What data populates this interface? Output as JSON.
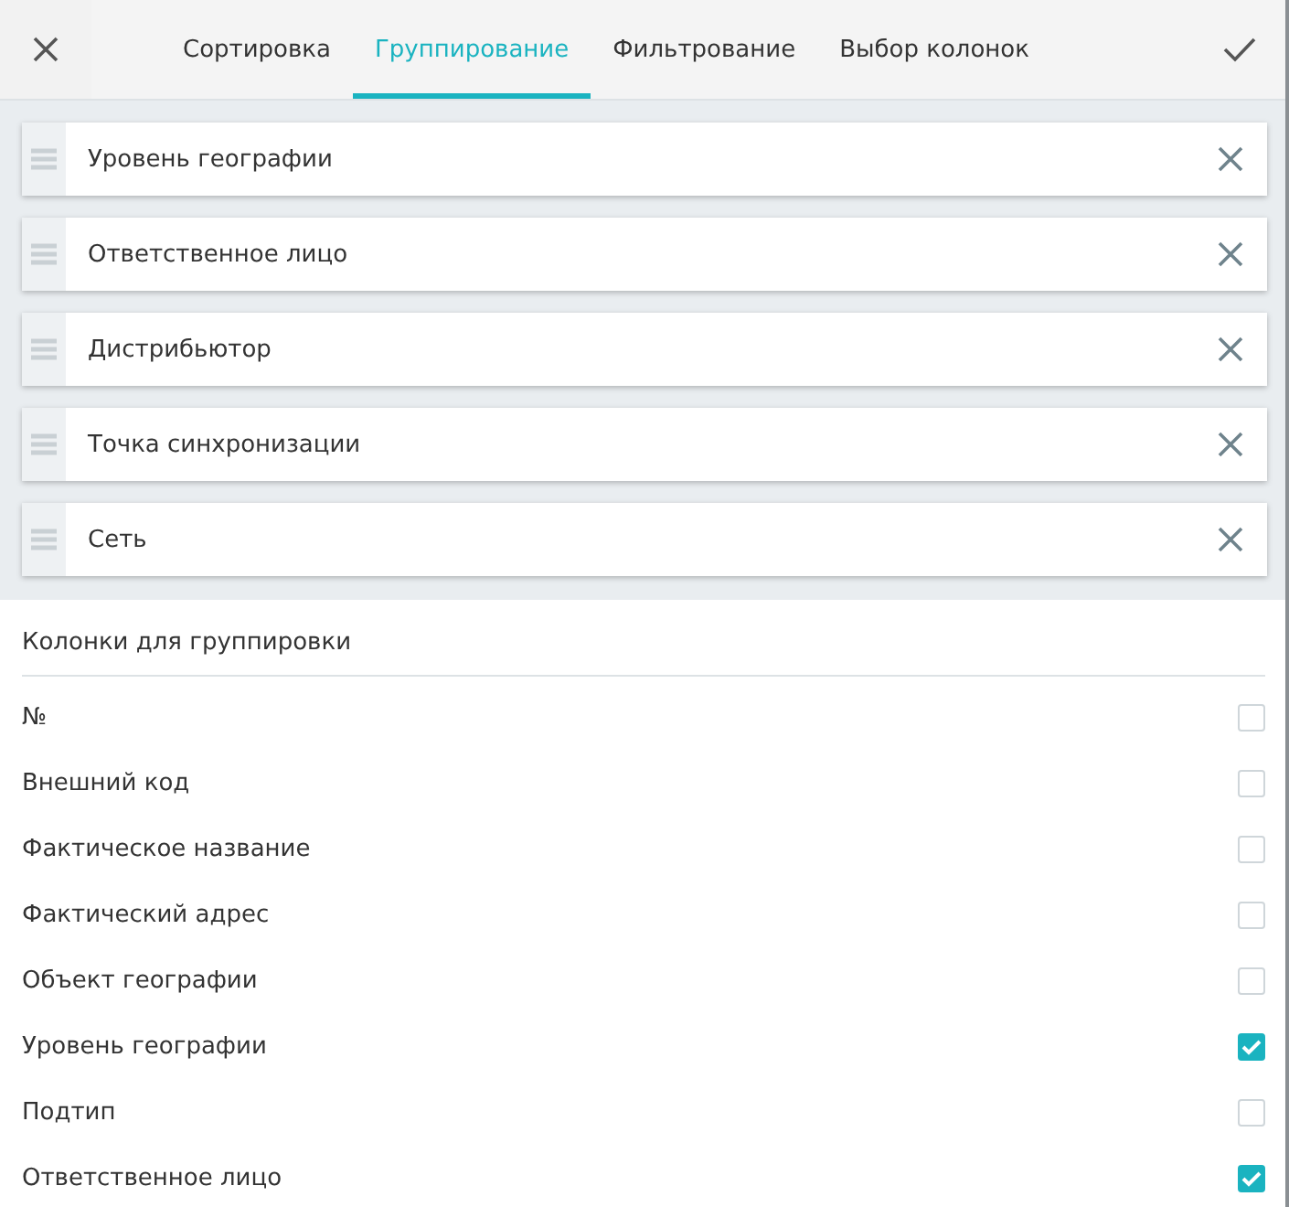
{
  "tabs": [
    {
      "label": "Сортировка",
      "selected": false
    },
    {
      "label": "Группирование",
      "selected": true
    },
    {
      "label": "Фильтрование",
      "selected": false
    },
    {
      "label": "Выбор колонок",
      "selected": false
    }
  ],
  "groups": [
    {
      "label": "Уровень географии"
    },
    {
      "label": "Ответственное лицо"
    },
    {
      "label": "Дистрибьютор"
    },
    {
      "label": "Точка синхронизации"
    },
    {
      "label": "Сеть"
    }
  ],
  "columns_heading": "Колонки для группировки",
  "columns": [
    {
      "label": "№",
      "checked": false
    },
    {
      "label": "Внешний код",
      "checked": false
    },
    {
      "label": "Фактическое название",
      "checked": false
    },
    {
      "label": "Фактический адрес",
      "checked": false
    },
    {
      "label": "Объект географии",
      "checked": false
    },
    {
      "label": "Уровень географии",
      "checked": true
    },
    {
      "label": "Подтип",
      "checked": false
    },
    {
      "label": "Ответственное лицо",
      "checked": true
    }
  ]
}
